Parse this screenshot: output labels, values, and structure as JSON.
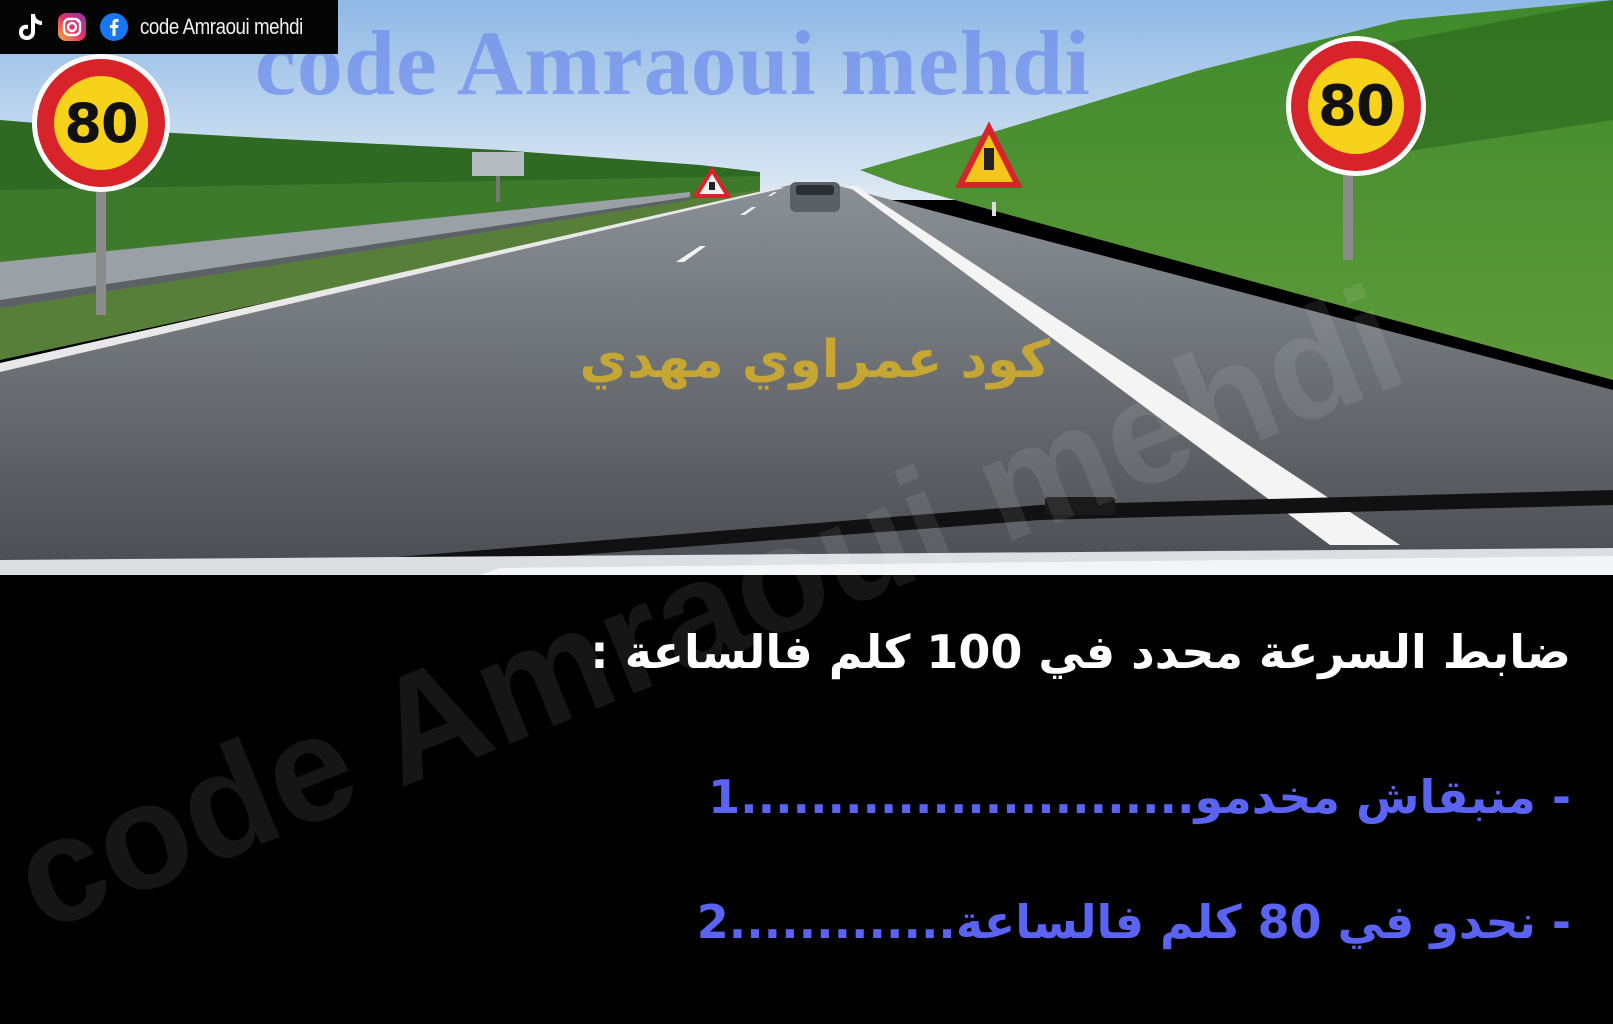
{
  "social": {
    "text": "code Amraoui mehdi",
    "icons": [
      "tiktok-icon",
      "instagram-icon",
      "facebook-icon"
    ]
  },
  "scene": {
    "speed_sign_left": "80",
    "speed_sign_right": "80"
  },
  "watermarks": {
    "top_latin": "code Amraoui mehdi",
    "center_arabic": "كود عمراوي مهدي",
    "panel_latin": "code Amraoui mehdi"
  },
  "question": {
    "text": "ضابط السرعة محدد في 100 كلم فالساعة :"
  },
  "answers": [
    {
      "text": "- منبقاش مخدمو..........................1"
    },
    {
      "text": "- نحدو في 80 كلم فالساعة.............2"
    }
  ],
  "colors": {
    "answer_text": "#5b63f2",
    "question_text": "#ffffff",
    "watermark_top": "#6e8ceb",
    "watermark_arabic": "#d6b028",
    "sign_ring": "#d8232a",
    "sign_fill": "#f6d21a"
  }
}
